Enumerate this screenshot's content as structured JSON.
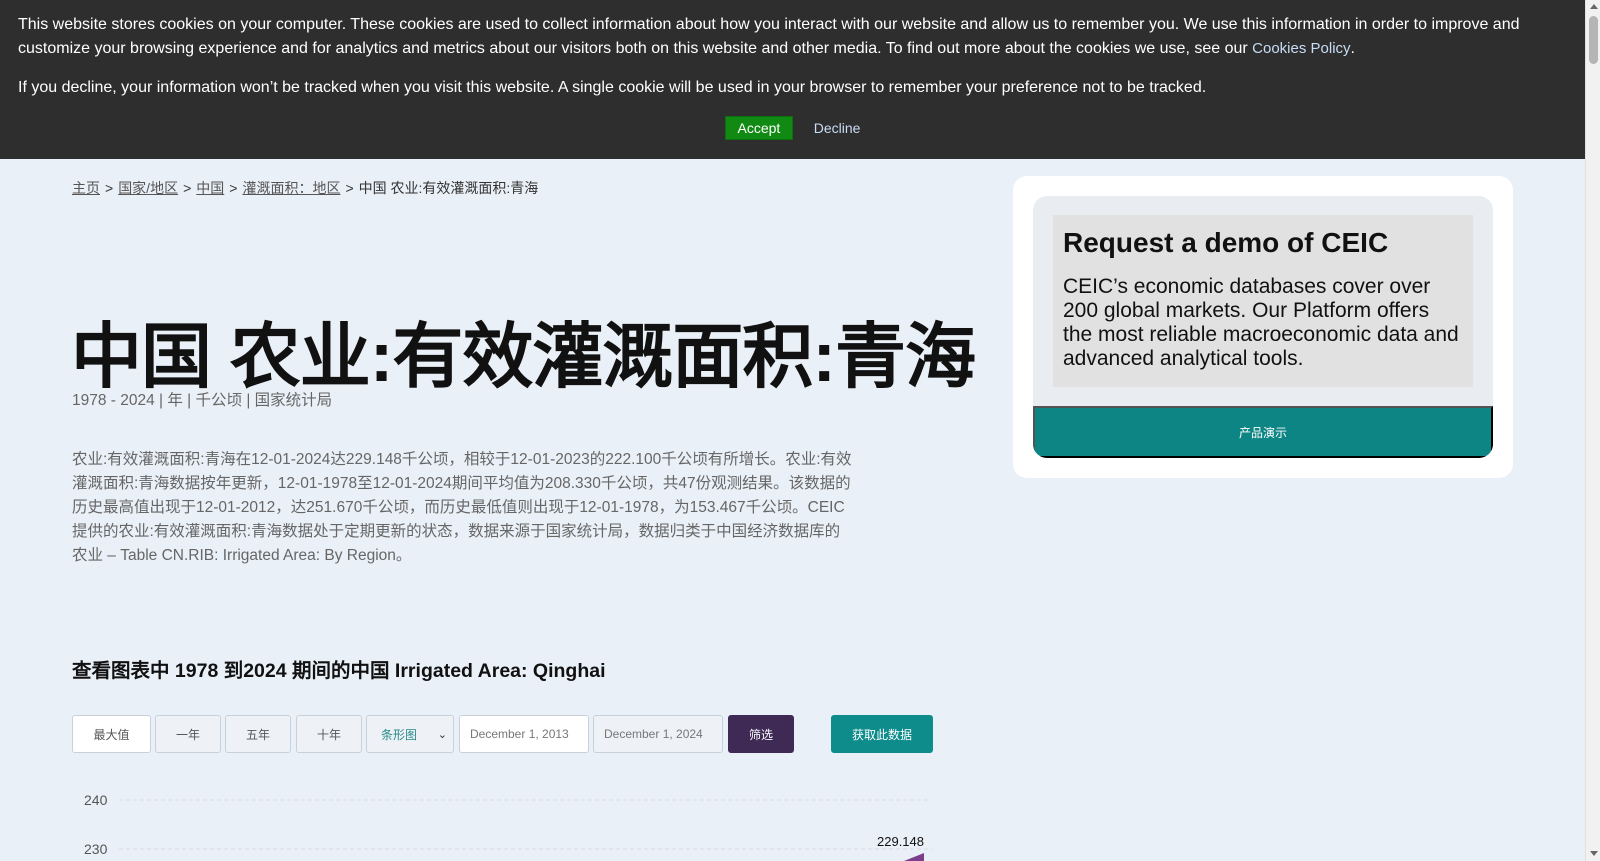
{
  "cookie": {
    "text1": "This website stores cookies on your computer. These cookies are used to collect information about how you interact with our website and allow us to remember you. We use this information in order to improve and customize your browsing experience and for analytics and metrics about our visitors both on this website and other media. To find out more about the cookies we use, see our ",
    "policy_link": "Cookies Policy",
    "text1_end": ".",
    "text2": "If you decline, your information won’t be tracked when you visit this website. A single cookie will be used in your browser to remember your preference not to be tracked.",
    "accept": "Accept",
    "decline": "Decline"
  },
  "breadcrumb": {
    "items": [
      "主页",
      "国家/地区",
      "中国",
      "灌溉面积：地区"
    ],
    "current": "中国 农业:有效灌溉面积:青海",
    "sep": ">"
  },
  "page": {
    "title": "中国 农业:有效灌溉面积:青海",
    "meta": "1978 - 2024 | 年 | 千公顷 | 国家统计局",
    "description": "农业:有效灌溉面积:青海在12-01-2024达229.148千公顷，相较于12-01-2023的222.100千公顷有所增长。农业:有效灌溉面积:青海数据按年更新，12-01-1978至12-01-2024期间平均值为208.330千公顷，共47份观测结果。该数据的历史最高值出现于12-01-2012，达251.670千公顷，而历史最低值则出现于12-01-1978，为153.467千公顷。CEIC提供的农业:有效灌溉面积:青海数据处于定期更新的状态，数据来源于国家统计局，数据归类于中国经济数据库的农业 – Table CN.RIB: Irrigated Area: By Region。",
    "chart_heading": "查看图表中 1978 到2024 期间的中国 Irrigated Area: Qinghai"
  },
  "controls": {
    "max": "最大值",
    "one_year": "一年",
    "five_year": "五年",
    "ten_year": "十年",
    "chart_type": "条形图",
    "date_from": "December 1, 2013",
    "date_to": "December 1, 2024",
    "filter": "筛选",
    "get_data": "获取此数据"
  },
  "chart_data": {
    "type": "bar",
    "y_ticks": [
      "240",
      "230"
    ],
    "data_labels": [
      "229.148"
    ],
    "series_color": "#7b3f8c",
    "grid": true
  },
  "demo": {
    "title": "Request a demo of CEIC",
    "body": "CEIC’s economic databases cover over 200 global markets. Our Platform offers the most reliable macroeconomic data and advanced analytical tools.",
    "button": "产品演示"
  }
}
